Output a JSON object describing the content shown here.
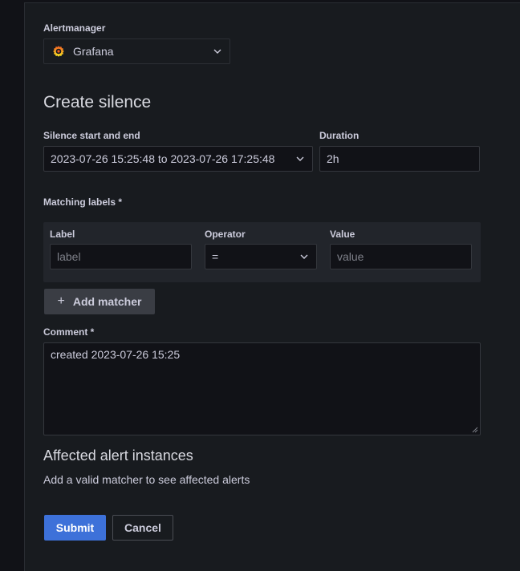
{
  "alertmanager": {
    "label": "Alertmanager",
    "selected": "Grafana",
    "icon": "grafana-logo-icon"
  },
  "page_title": "Create silence",
  "silence_period": {
    "label": "Silence start and end",
    "value": "2023-07-26 15:25:48 to 2023-07-26 17:25:48"
  },
  "duration": {
    "label": "Duration",
    "value": "2h"
  },
  "matching_labels": {
    "title": "Matching labels *",
    "columns": [
      "Label",
      "Operator",
      "Value"
    ],
    "label_placeholder": "label",
    "operator_value": "=",
    "value_placeholder": "value",
    "add_button": "Add matcher"
  },
  "comment": {
    "label": "Comment *",
    "value": "created 2023-07-26 15:25"
  },
  "affected": {
    "title": "Affected alert instances",
    "message": "Add a valid matcher to see affected alerts"
  },
  "actions": {
    "submit": "Submit",
    "cancel": "Cancel"
  },
  "colors": {
    "background": "#111217",
    "panel": "#181b1f",
    "primary": "#3d71d9"
  }
}
